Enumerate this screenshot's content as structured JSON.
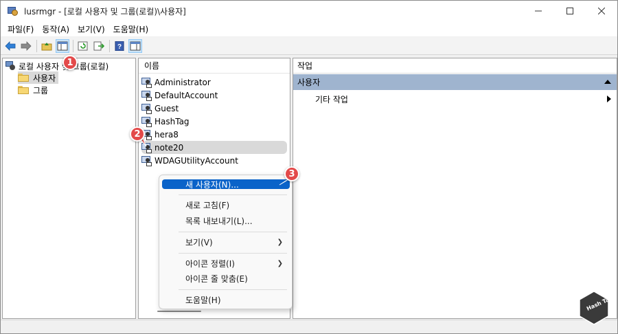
{
  "window": {
    "title": "lusrmgr - [로컬 사용자 및 그룹(로컬)\\사용자]",
    "controls": [
      "minimize",
      "maximize",
      "close"
    ]
  },
  "menu": {
    "items": [
      "파일(F)",
      "동작(A)",
      "보기(V)",
      "도움말(H)"
    ]
  },
  "toolbar": {
    "buttons": [
      "back-icon",
      "forward-icon",
      "up-folder-icon",
      "show-hide-tree-icon",
      "refresh-icon",
      "export-list-icon",
      "help-icon",
      "action-pane-icon"
    ]
  },
  "tree": {
    "root": "로컬 사용자 및 그룹(로컬)",
    "children": [
      "사용자",
      "그룹"
    ],
    "selected": "사용자"
  },
  "list": {
    "column_header": "이름",
    "items": [
      "Administrator",
      "DefaultAccount",
      "Guest",
      "HashTag",
      "hera8",
      "note20",
      "WDAGUtilityAccount"
    ],
    "selected": "note20"
  },
  "actions": {
    "header": "작업",
    "section": "사용자",
    "more_actions": "기타 작업"
  },
  "context_menu": {
    "items": [
      {
        "label": "새 사용자(N)..."
      },
      {
        "label": "새로 고침(F)"
      },
      {
        "label": "목록 내보내기(L)..."
      },
      {
        "label": "보기(V)"
      },
      {
        "label": "아이콘 정렬(I)"
      },
      {
        "label": "아이콘 줄 맞춤(E)"
      },
      {
        "label": "도움말(H)"
      }
    ]
  },
  "badges": [
    "1",
    "2",
    "3"
  ],
  "watermark": "Hash Tag",
  "colors": {
    "section_bg": "#9fb4cf",
    "highlight": "#0a63c9",
    "badge": "#e34a4a"
  }
}
